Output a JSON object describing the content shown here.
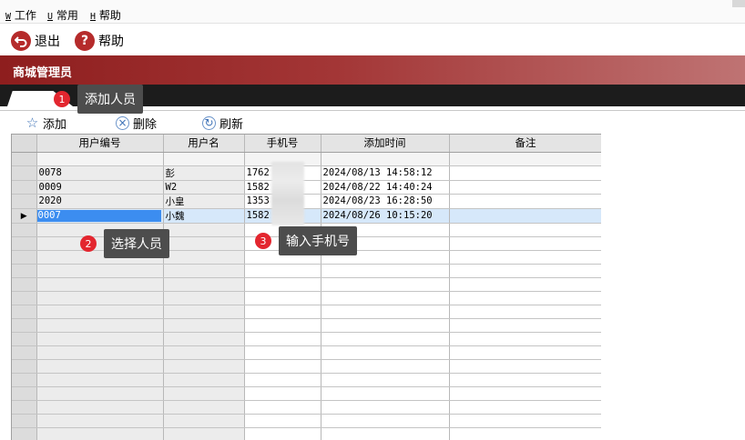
{
  "menubar": {
    "items": [
      {
        "hotkey": "W",
        "label": "工作"
      },
      {
        "hotkey": "U",
        "label": "常用"
      },
      {
        "hotkey": "H",
        "label": "帮助"
      }
    ]
  },
  "toolbar": {
    "exit_label": "退出",
    "help_label": "帮助"
  },
  "window": {
    "title": "商城管理员"
  },
  "grid_toolbar": {
    "add_label": "添加",
    "delete_label": "删除",
    "refresh_label": "刷新"
  },
  "table": {
    "columns": [
      "用户编号",
      "用户名",
      "手机号",
      "添加时间",
      "备注"
    ],
    "rows": [
      {
        "id": "0078",
        "name": "彭",
        "phone": "1762",
        "time": "2024/08/13 14:58:12",
        "note": ""
      },
      {
        "id": "0009",
        "name": "W2",
        "phone": "1582",
        "time": "2024/08/22 14:40:24",
        "note": ""
      },
      {
        "id": "2020",
        "name": "小皇",
        "phone": "1353",
        "time": "2024/08/23 16:28:50",
        "note": ""
      },
      {
        "id": "0007",
        "name": "小魏",
        "phone": "1582",
        "time": "2024/08/26 10:15:20",
        "note": ""
      }
    ],
    "selected_row": 3
  },
  "callouts": [
    {
      "number": "1",
      "text": "添加人员"
    },
    {
      "number": "2",
      "text": "选择人员"
    },
    {
      "number": "3",
      "text": "输入手机号"
    }
  ],
  "colors": {
    "title_band": "#8e1e1e",
    "callout_badge": "#e3262f",
    "callout_bubble": "#4d4d4d",
    "selection": "#3c8df0"
  }
}
